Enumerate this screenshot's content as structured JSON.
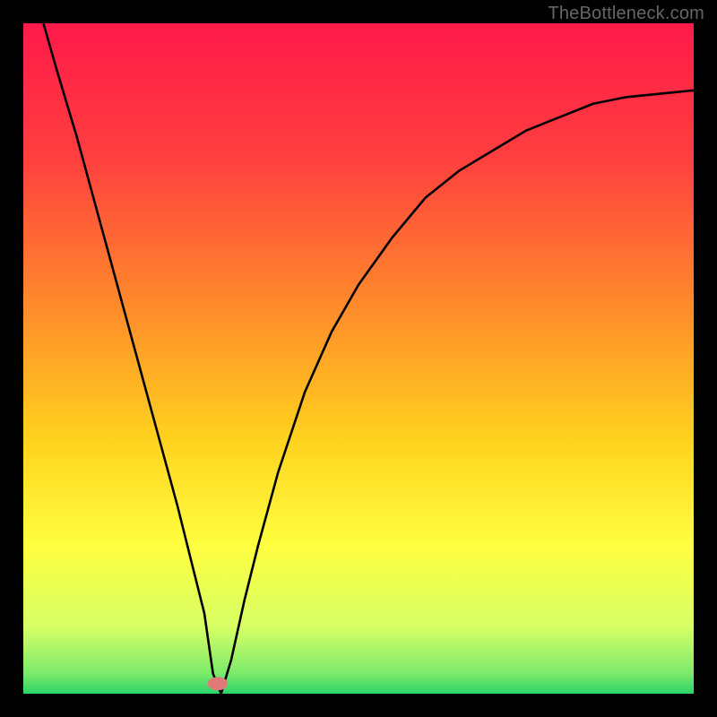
{
  "watermark": "TheBottleneck.com",
  "chart_data": {
    "type": "line",
    "title": "",
    "xlabel": "",
    "ylabel": "",
    "xlim": [
      0,
      100
    ],
    "ylim": [
      0,
      100
    ],
    "grid": false,
    "legend": false,
    "background_gradient": [
      {
        "pos": 0.0,
        "color": "#ff1a4a"
      },
      {
        "pos": 0.2,
        "color": "#ff3f3f"
      },
      {
        "pos": 0.42,
        "color": "#ff8a2b"
      },
      {
        "pos": 0.62,
        "color": "#ffd21e"
      },
      {
        "pos": 0.78,
        "color": "#ffff40"
      },
      {
        "pos": 0.9,
        "color": "#d7ff66"
      },
      {
        "pos": 0.97,
        "color": "#7cea6a"
      },
      {
        "pos": 1.0,
        "color": "#2bd56a"
      }
    ],
    "series": [
      {
        "name": "bottleneck-curve",
        "stroke": "#000000",
        "x": [
          3,
          5,
          8,
          11,
          14,
          17,
          20,
          23,
          25,
          27,
          28.3,
          29.5,
          31,
          33,
          35,
          38,
          42,
          46,
          50,
          55,
          60,
          65,
          70,
          75,
          80,
          85,
          90,
          95,
          100
        ],
        "y": [
          100,
          93,
          83,
          72,
          61,
          50,
          39,
          28,
          20,
          12,
          3,
          0,
          5,
          14,
          22,
          33,
          45,
          54,
          61,
          68,
          74,
          78,
          81,
          84,
          86,
          88,
          89,
          89.5,
          90
        ]
      }
    ],
    "marker": {
      "x": 29.0,
      "y": 1.5,
      "color": "#e07a7a",
      "rx": 1.5,
      "ry": 1.0
    }
  }
}
